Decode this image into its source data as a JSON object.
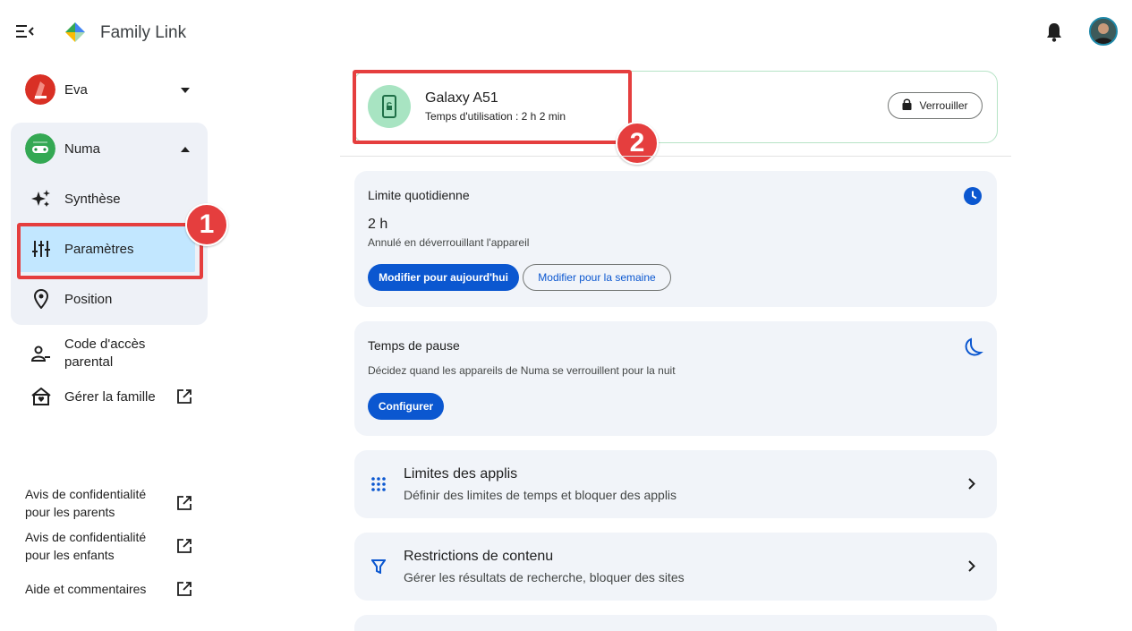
{
  "header": {
    "app_title": "Family Link"
  },
  "sidebar": {
    "children": [
      {
        "name": "Eva"
      },
      {
        "name": "Numa"
      }
    ],
    "nav": [
      {
        "label": "Synthèse"
      },
      {
        "label": "Paramètres"
      },
      {
        "label": "Position"
      }
    ],
    "parent_code_label": "Code d'accès parental",
    "family_label": "Gérer la famille",
    "footer_links": [
      {
        "label": "Avis de confidentialité pour les parents"
      },
      {
        "label": "Avis de confidentialité pour les enfants"
      },
      {
        "label": "Aide et commentaires"
      }
    ]
  },
  "annotations": {
    "badge1": "1",
    "badge2": "2"
  },
  "device": {
    "name": "Galaxy A51",
    "usage": "Temps d'utilisation : 2 h 2 min",
    "lock_label": "Verrouiller"
  },
  "daily_limit": {
    "title": "Limite quotidienne",
    "value": "2 h",
    "note": "Annulé en déverrouillant l'appareil",
    "today_button": "Modifier pour aujourd'hui",
    "week_button": "Modifier pour la semaine"
  },
  "downtime": {
    "title": "Temps de pause",
    "description": "Décidez quand les appareils de Numa se verrouillent pour la nuit",
    "configure_button": "Configurer"
  },
  "app_limits": {
    "title": "Limites des applis",
    "subtitle": "Définir des limites de temps et bloquer des applis"
  },
  "content_restrictions": {
    "title": "Restrictions de contenu",
    "subtitle": "Gérer les résultats de recherche, bloquer des sites"
  },
  "colors": {
    "accent": "#0b57d0",
    "highlight": "#e53e3e",
    "active_nav": "#c2e7ff"
  }
}
